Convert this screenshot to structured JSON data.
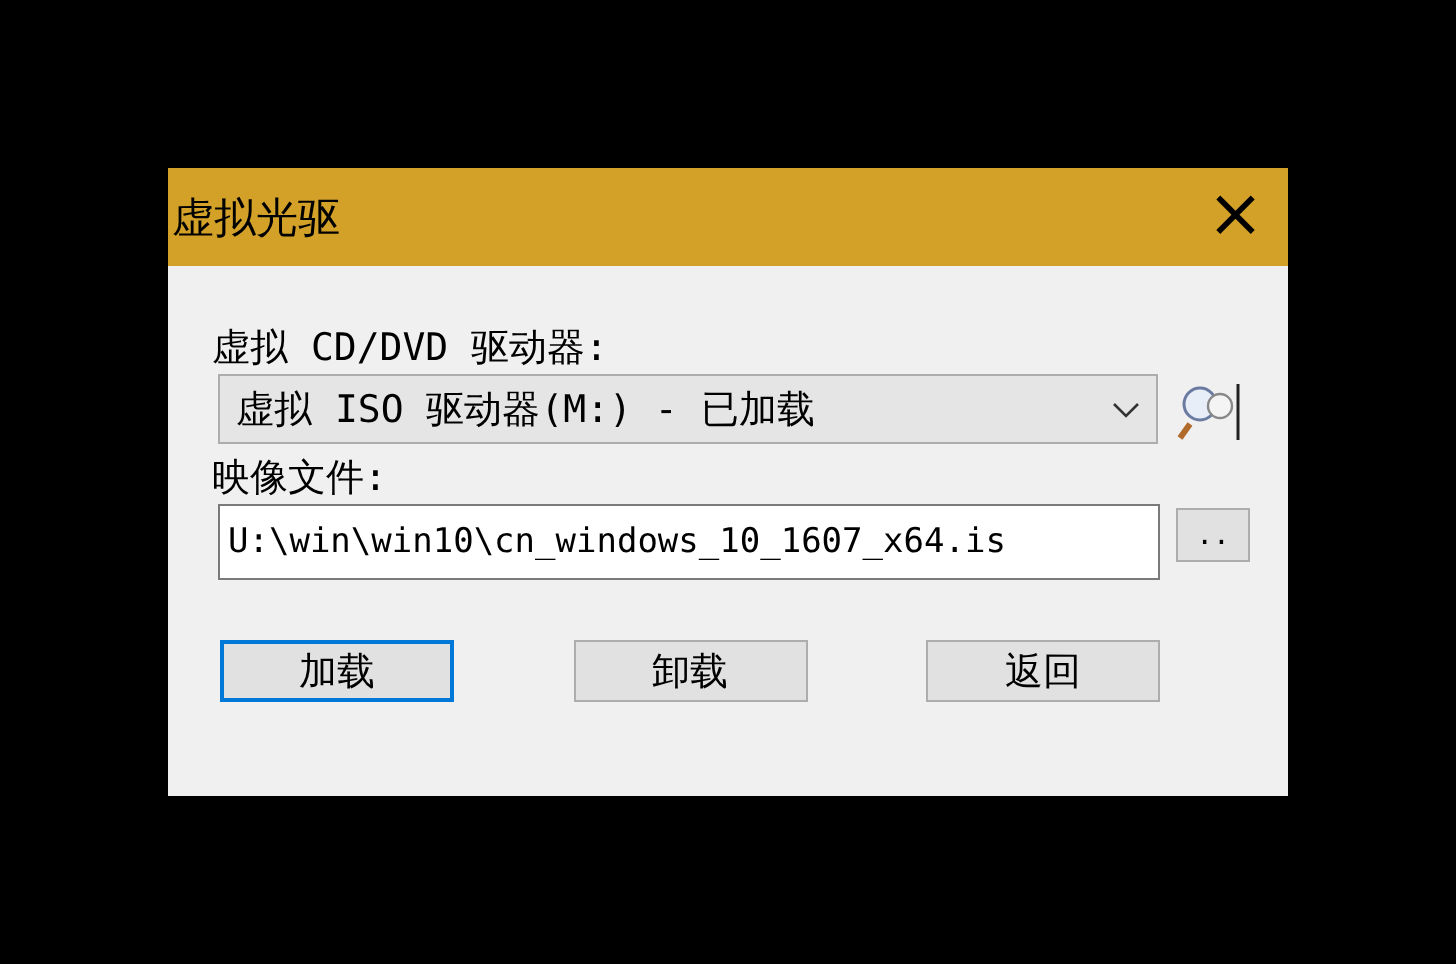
{
  "window": {
    "title": "虚拟光驱",
    "close": "×"
  },
  "drive": {
    "label": "虚拟 CD/DVD 驱动器:",
    "value": "虚拟 ISO 驱动器(M:) - 已加载"
  },
  "image": {
    "label": "映像文件:",
    "value": "U:\\win\\win10\\cn_windows_10_1607_x64.is",
    "browse": ".."
  },
  "buttons": [
    {
      "label": "加载",
      "default": true
    },
    {
      "label": "卸载",
      "default": false
    },
    {
      "label": "返回",
      "default": false
    }
  ]
}
